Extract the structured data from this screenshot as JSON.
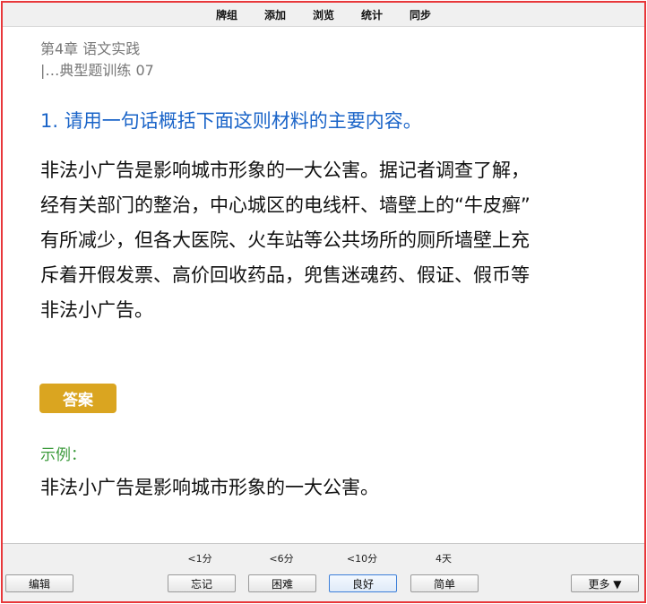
{
  "menu": {
    "items": [
      "牌组",
      "添加",
      "浏览",
      "统计",
      "同步"
    ]
  },
  "card": {
    "chapter": "第4章 语文实践",
    "subsection": "|…典型题训练 07",
    "question": "1. 请用一句话概括下面这则材料的主要内容。",
    "passage_lines": [
      "非法小广告是影响城市形象的一大公害。据记者调查了解，",
      "经有关部门的整治，中心城区的电线杆、墙壁上的“牛皮癣”",
      "有所减少，但各大医院、火车站等公共场所的厕所墙壁上充",
      "斥着开假发票、高价回收药品，兜售迷魂药、假证、假币等",
      "非法小广告。"
    ],
    "answer_label": "答案",
    "example_label": "示例：",
    "example_text": "非法小广告是影响城市形象的一大公害。"
  },
  "bottom": {
    "edit_label": "编辑",
    "more_label": "更多 ▼",
    "answers": [
      {
        "interval": "<1分",
        "label": "忘记"
      },
      {
        "interval": "<6分",
        "label": "困难"
      },
      {
        "interval": "<10分",
        "label": "良好"
      },
      {
        "interval": "4天",
        "label": "简单"
      }
    ]
  },
  "colors": {
    "frame_border": "#e8373a",
    "question": "#1a64c8",
    "answer_button": "#daa520",
    "example_label": "#3c9a3c"
  }
}
